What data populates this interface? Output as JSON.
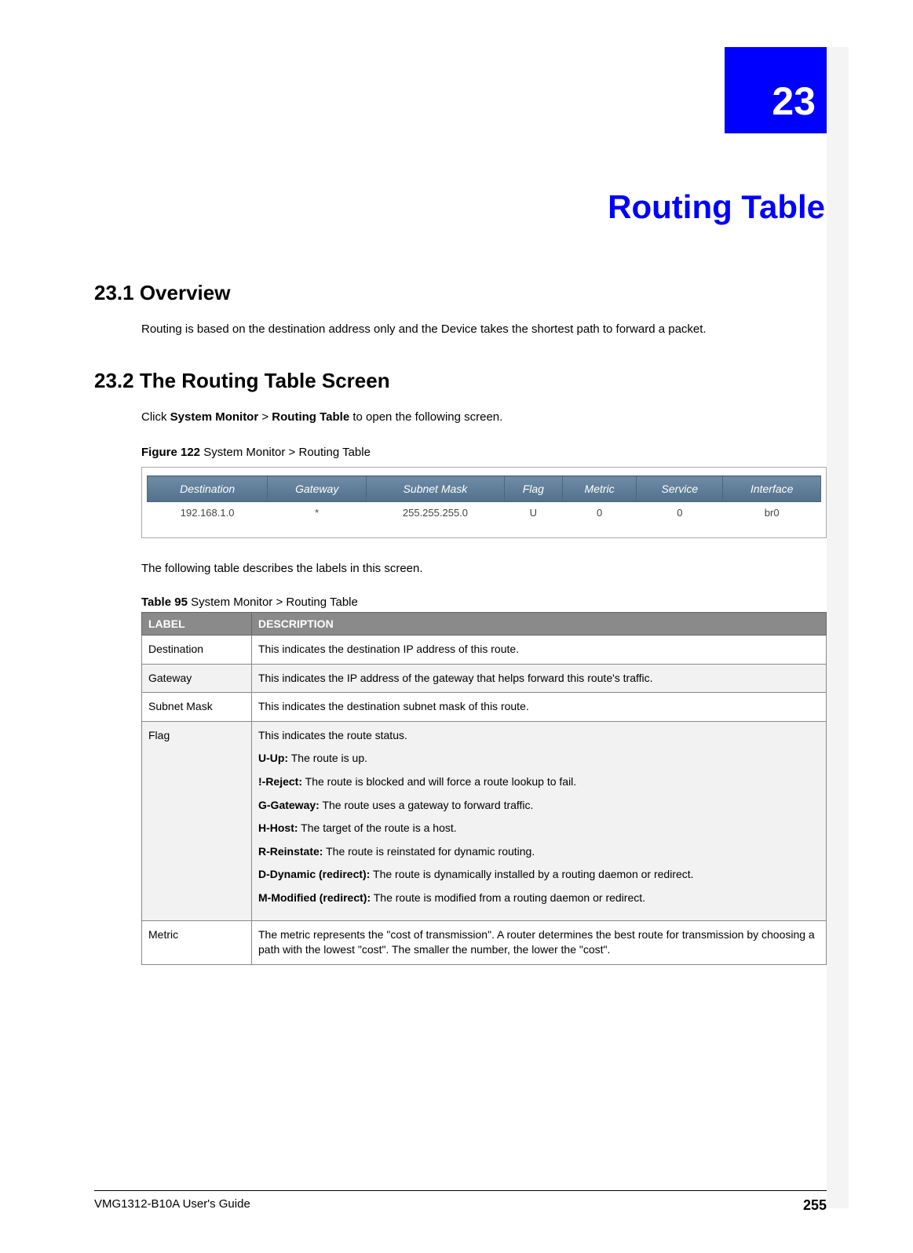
{
  "chapter_number": "23",
  "chapter_title": "Routing Table",
  "section1": {
    "heading": "23.1  Overview",
    "paragraph": "Routing is based on the destination address only and the Device takes the shortest path to forward a packet."
  },
  "section2": {
    "heading": "23.2  The Routing Table Screen",
    "intro_prefix": "Click ",
    "intro_bold1": "System Monitor",
    "intro_mid": " > ",
    "intro_bold2": "Routing Table",
    "intro_suffix": " to open the following screen.",
    "figure_label": "Figure 122",
    "figure_caption": "   System Monitor > Routing Table",
    "screenshot": {
      "headers": [
        "Destination",
        "Gateway",
        "Subnet Mask",
        "Flag",
        "Metric",
        "Service",
        "Interface"
      ],
      "row": [
        "192.168.1.0",
        "*",
        "255.255.255.0",
        "U",
        "0",
        "0",
        "br0"
      ]
    },
    "after_figure": "The following table describes the labels in this screen.",
    "table_label": "Table 95",
    "table_caption": "   System Monitor > Routing Table",
    "desc_headers": [
      "LABEL",
      "DESCRIPTION"
    ],
    "rows": [
      {
        "label": "Destination",
        "desc": "This indicates the destination IP address of this route."
      },
      {
        "label": "Gateway",
        "desc": "This indicates the IP address of the gateway that helps forward this route's traffic."
      },
      {
        "label": "Subnet Mask",
        "desc": "This indicates the destination subnet mask of this route."
      },
      {
        "label": "Flag",
        "desc_intro": "This indicates the route status.",
        "flags": [
          {
            "b": "U-Up:",
            "t": " The route is up."
          },
          {
            "b": "!-Reject:",
            "t": " The route is blocked and will force a route lookup to fail."
          },
          {
            "b": "G-Gateway:",
            "t": " The route uses a gateway to forward traffic."
          },
          {
            "b": "H-Host:",
            "t": " The target of the route is a host."
          },
          {
            "b": "R-Reinstate:",
            "t": " The route is reinstated for dynamic routing."
          },
          {
            "b": "D-Dynamic (redirect):",
            "t": " The route is dynamically installed by a routing daemon or redirect."
          },
          {
            "b": "M-Modified (redirect):",
            "t": " The route is modified from a routing daemon or redirect."
          }
        ]
      },
      {
        "label": "Metric",
        "desc": "The metric represents the \"cost of transmission\". A router determines the best route for transmission by choosing a path with the lowest \"cost\". The smaller the number, the lower the \"cost\"."
      }
    ]
  },
  "footer": {
    "doc_title": "VMG1312-B10A User's Guide",
    "page_number": "255"
  }
}
